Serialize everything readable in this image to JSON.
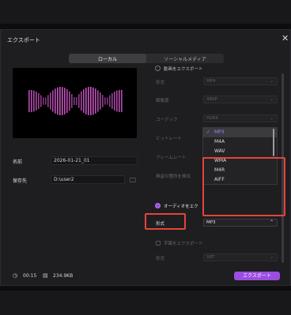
{
  "window": {
    "title": "エクスポート"
  },
  "tabs": [
    {
      "label": "ローカル",
      "active": true
    },
    {
      "label": "ソーシャルメディア",
      "active": false
    }
  ],
  "left": {
    "name_label": "名前",
    "name_value": "2026-01-21_01",
    "save_label": "保存先",
    "save_value": "D:\\user2"
  },
  "video_section": {
    "label": "動画をエクスポート"
  },
  "settings": [
    {
      "label": "形式",
      "value": "MP4"
    },
    {
      "label": "解像度",
      "value": "480P"
    },
    {
      "label": "コーデック",
      "value": "H264"
    },
    {
      "label": "ビットレート",
      "value": "推奨"
    },
    {
      "label": "フレームレート",
      "value": ""
    },
    {
      "label": "無音の箇所を検出",
      "value": ""
    }
  ],
  "audio_section": {
    "label": "オーディオをエク"
  },
  "audio_format": {
    "label": "形式",
    "value": "MP3"
  },
  "subtitle_section": {
    "label": "字幕をエクスポート",
    "format": "SRT"
  },
  "dropdown": {
    "options": [
      "MP3",
      "M4A",
      "WAV",
      "WMA",
      "M4R",
      "AIFF"
    ],
    "selected": "MP3"
  },
  "footer": {
    "duration": "00:15",
    "size": "234.9KB",
    "export_label": "エクスポート"
  },
  "colors": {
    "accent": "#9b4de0",
    "highlight": "#e2453a"
  }
}
